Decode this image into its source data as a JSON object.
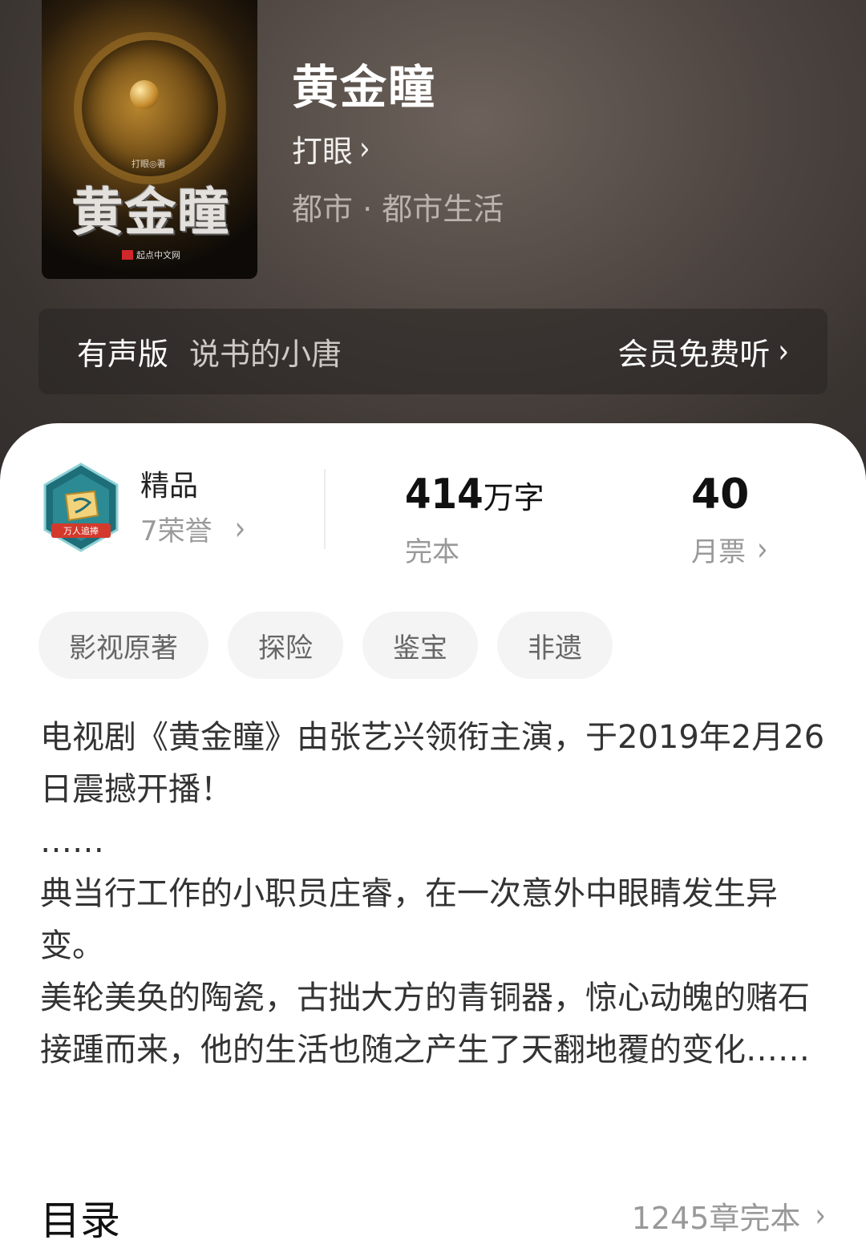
{
  "cover": {
    "title_art": "黄金瞳",
    "author_mark": "打眼◎著",
    "publisher": "起点中文网"
  },
  "book": {
    "title": "黄金瞳",
    "author": "打眼",
    "category": "都市 · 都市生活"
  },
  "audio": {
    "label": "有声版",
    "narrator": "说书的小唐",
    "action": "会员免费听"
  },
  "honor": {
    "badge_text": "万人追捧",
    "title": "精品",
    "count": "7荣誉"
  },
  "stats": {
    "word_count": "414",
    "word_unit": "万字",
    "status": "完本",
    "monthly_votes": "40",
    "votes_label": "月票"
  },
  "tags": [
    "影视原著",
    "探险",
    "鉴宝",
    "非遗"
  ],
  "synopsis": [
    "电视剧《黄金瞳》由张艺兴领衔主演，于2019年2月26日震撼开播！",
    "……",
    "典当行工作的小职员庄睿，在一次意外中眼睛发生异变。",
    "美轮美奂的陶瓷，古拙大方的青铜器，惊心动魄的赌石接踵而来，他的生活也随之产生了天翻地覆的变化……"
  ],
  "toc": {
    "title": "目录",
    "summary": "1245章完本"
  },
  "icons": {
    "chevron": "chevron-right-icon",
    "badge": "honor-badge-icon"
  }
}
